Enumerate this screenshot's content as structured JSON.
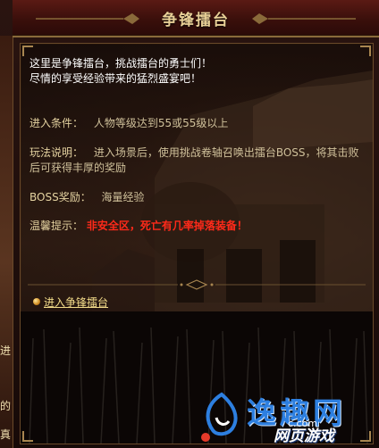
{
  "window": {
    "title": "争锋擂台"
  },
  "left_strip": {
    "fragments": [
      "进",
      "的",
      "真"
    ]
  },
  "intro": {
    "line1": "这里是争锋擂台，挑战擂台的勇士们！",
    "line2": "尽情的享受经验带来的猛烈盛宴吧！"
  },
  "info": {
    "condition_label": "进入条件：",
    "condition_value": "人物等级达到55或55级以上",
    "rules_label": "玩法说明：",
    "rules_value_line1": "进入场景后，使用挑战卷轴召唤出擂台BOSS，将其击败",
    "rules_value_line2": "后可获得丰厚的奖励",
    "reward_label": "BOSS奖励：",
    "reward_value": "海量经验",
    "tip_label": "温馨提示：",
    "tip_value": "非安全区，死亡有几率掉落装备！"
  },
  "actions": {
    "enter_link": "进入争锋擂台"
  },
  "watermark": {
    "main": "逸趣网",
    "sub": "网页游戏",
    "url": "c.com"
  }
}
